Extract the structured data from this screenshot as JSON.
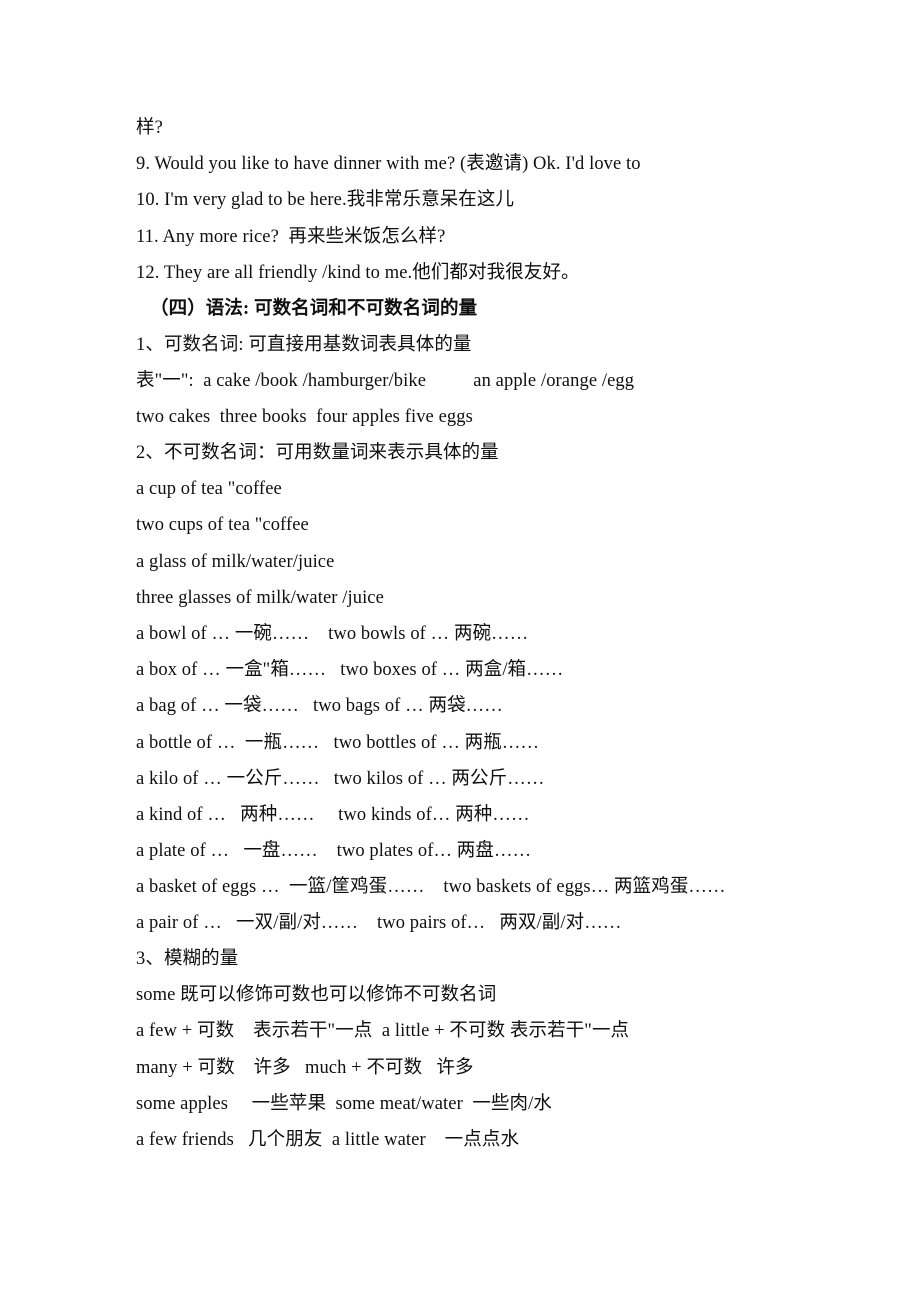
{
  "document": {
    "page_background": "#ffffff",
    "text_color": "#111111",
    "lines": [
      {
        "id": "line-continuation-yang",
        "text": "样?",
        "style": "normal"
      },
      {
        "id": "line-item-9",
        "text": "9. Would you like to have dinner with me? (表邀请) Ok. I'd love to",
        "style": "normal"
      },
      {
        "id": "line-item-10",
        "text": "10. I'm very glad to be here.我非常乐意呆在这儿",
        "style": "normal"
      },
      {
        "id": "line-item-11",
        "text": "11. Any more rice?  再来些米饭怎么样?",
        "style": "normal"
      },
      {
        "id": "line-item-12",
        "text": "12. They are all friendly /kind to me.他们都对我很友好。",
        "style": "normal"
      },
      {
        "id": "line-heading-grammar",
        "text": "（四）语法: 可数名词和不可数名词的量",
        "style": "heading"
      },
      {
        "id": "line-countable-rule",
        "text": "1、可数名词: 可直接用基数词表具体的量",
        "style": "normal"
      },
      {
        "id": "line-countable-examples-singular",
        "text": "表\"一\":  a cake /book /hamburger/bike          an apple /orange /egg",
        "style": "normal"
      },
      {
        "id": "line-countable-examples-plural",
        "text": "two cakes  three books  four apples five eggs",
        "style": "tight"
      },
      {
        "id": "line-uncountable-rule",
        "text": "2、不可数名词：可用数量词来表示具体的量",
        "style": "normal"
      },
      {
        "id": "line-cup-of-tea",
        "text": "a cup of tea \"coffee",
        "style": "normal"
      },
      {
        "id": "line-two-cups-of-tea",
        "text": "two cups of tea \"coffee",
        "style": "normal"
      },
      {
        "id": "line-glass-of-milk",
        "text": "a glass of milk/water/juice",
        "style": "normal"
      },
      {
        "id": "line-three-glasses-of-milk",
        "text": "three glasses of milk/water /juice",
        "style": "normal"
      },
      {
        "id": "line-bowl-of",
        "text": "a bowl of … 一碗……    two bowls of … 两碗……",
        "style": "normal"
      },
      {
        "id": "line-box-of",
        "text": "a box of … 一盒\"箱……   two boxes of … 两盒/箱……",
        "style": "normal"
      },
      {
        "id": "line-bag-of",
        "text": "a bag of … 一袋……   two bags of … 两袋……",
        "style": "normal"
      },
      {
        "id": "line-bottle-of",
        "text": "a bottle of …  一瓶……   two bottles of … 两瓶……",
        "style": "normal"
      },
      {
        "id": "line-kilo-of",
        "text": "a kilo of … 一公斤……   two kilos of … 两公斤……",
        "style": "normal"
      },
      {
        "id": "line-kind-of",
        "text": "a kind of …   两种……     two kinds of… 两种……",
        "style": "normal"
      },
      {
        "id": "line-plate-of",
        "text": "a plate of …   一盘……    two plates of… 两盘……",
        "style": "normal"
      },
      {
        "id": "line-basket-of-eggs",
        "text": "a basket of eggs …  一篮/筐鸡蛋……    two baskets of eggs… 两篮鸡蛋……",
        "style": "normal"
      },
      {
        "id": "line-pair-of",
        "text": "a pair of …   一双/副/对……    two pairs of…   两双/副/对……",
        "style": "normal"
      },
      {
        "id": "line-vague-quantity-rule",
        "text": "3、模糊的量",
        "style": "tight"
      },
      {
        "id": "line-some-rule",
        "text": "some 既可以修饰可数也可以修饰不可数名词",
        "style": "normal"
      },
      {
        "id": "line-a-few-a-little",
        "text": "a few + 可数    表示若干\"一点  a little + 不可数 表示若干\"一点",
        "style": "normal"
      },
      {
        "id": "line-many-much",
        "text": "many + 可数    许多   much + 不可数   许多",
        "style": "normal"
      },
      {
        "id": "line-some-examples",
        "text": "some apples     一些苹果  some meat/water  一些肉/水",
        "style": "normal"
      },
      {
        "id": "line-a-few-examples",
        "text": "a few friends   几个朋友  a little water    一点点水",
        "style": "normal"
      }
    ]
  }
}
